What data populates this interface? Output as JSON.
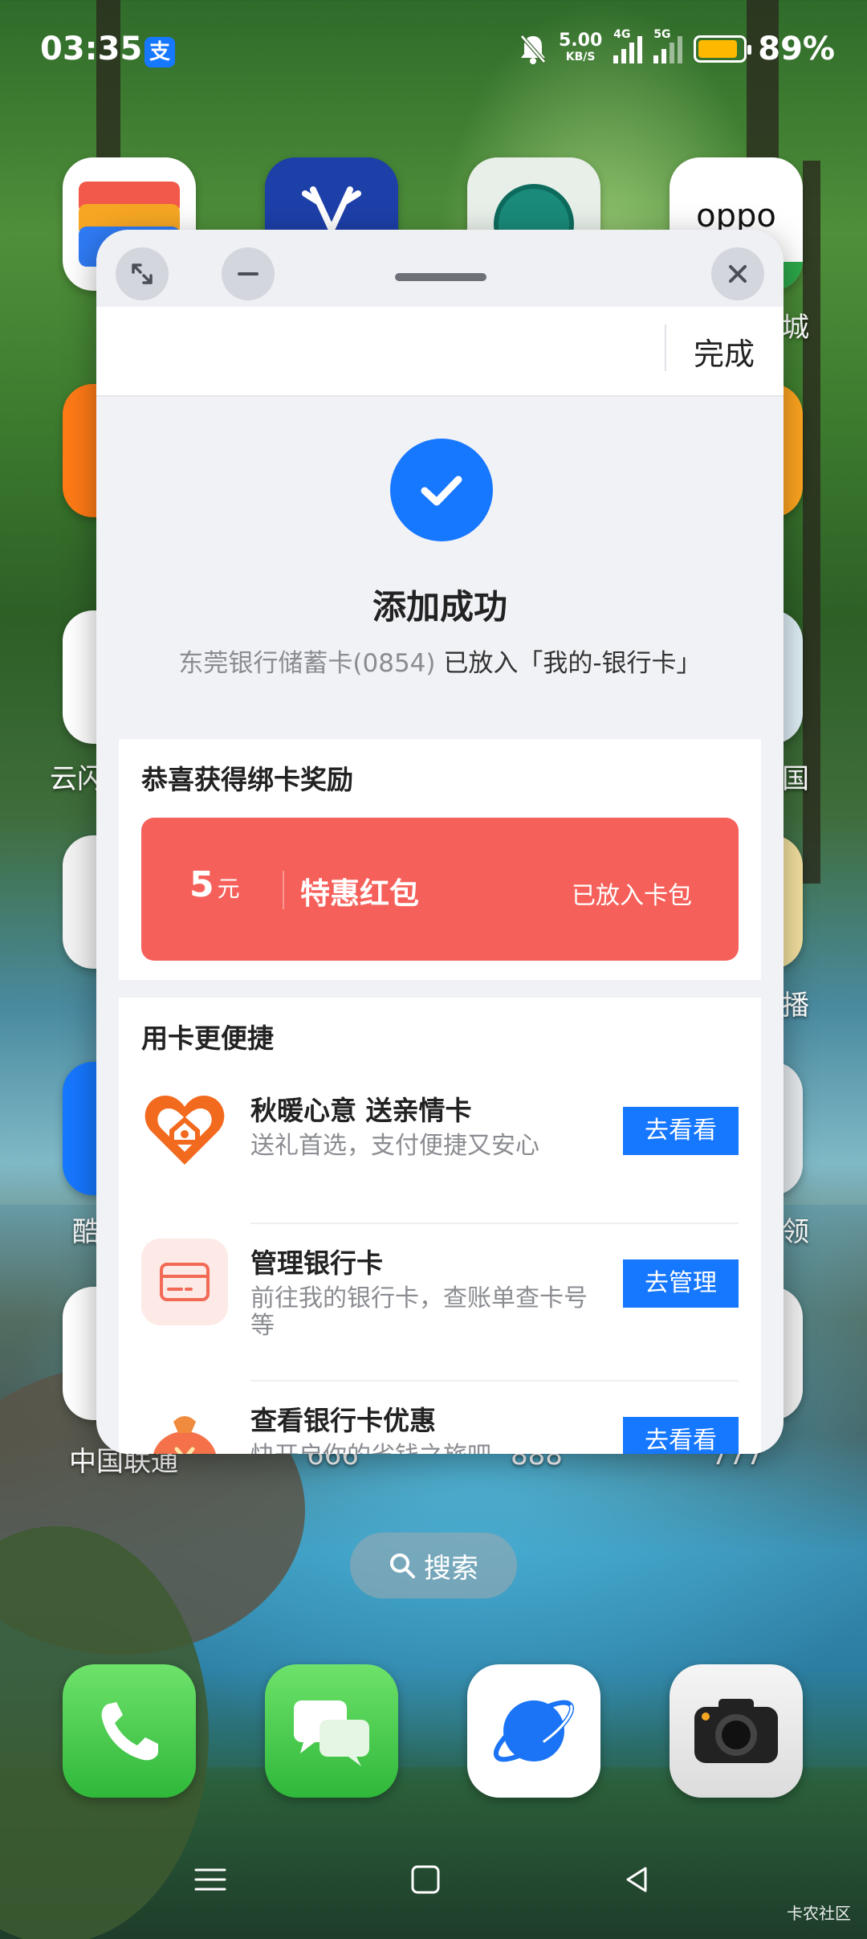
{
  "status_bar": {
    "time": "03:35",
    "alipay_badge": "支",
    "net_speed_value": "5.00",
    "net_speed_unit": "KB/S",
    "signal1_tag": "4G",
    "signal2_tag": "5G",
    "battery_percent": "89%",
    "battery_level": 0.89,
    "battery_color": "#ffb800"
  },
  "home": {
    "labels": [
      "云闪",
      "中国联通",
      "666",
      "888",
      "777",
      "城",
      "国",
      "酷",
      "播",
      "领"
    ],
    "oppo_label": "oppo"
  },
  "popup": {
    "done_label": "完成",
    "success": {
      "title": "添加成功",
      "subtitle_card": "东莞银行储蓄卡(0854)",
      "subtitle_rest": " 已放入「我的-银行卡」"
    },
    "reward": {
      "title": "恭喜获得绑卡奖励",
      "amount": "5",
      "unit": "元",
      "name": "特惠红包",
      "status": "已放入卡包",
      "color": "#f6605a"
    },
    "features": {
      "title": "用卡更便捷",
      "items": [
        {
          "title": "秋暖心意 送亲情卡",
          "desc": "送礼首选，支付便捷又安心",
          "button": "去看看",
          "icon": "heart-home-icon"
        },
        {
          "title": "管理银行卡",
          "desc": "前往我的银行卡，查账单查卡号等",
          "button": "去管理",
          "icon": "bank-card-icon"
        },
        {
          "title": "查看银行卡优惠",
          "desc": "快开启你的省钱之旅吧",
          "button": "去看看",
          "icon": "money-bag-icon"
        }
      ]
    },
    "accent_color": "#1677ff"
  },
  "search": {
    "label": "搜索"
  },
  "dock": [
    "phone-icon",
    "messages-icon",
    "browser-icon",
    "camera-icon"
  ],
  "watermark": "卡农社区"
}
